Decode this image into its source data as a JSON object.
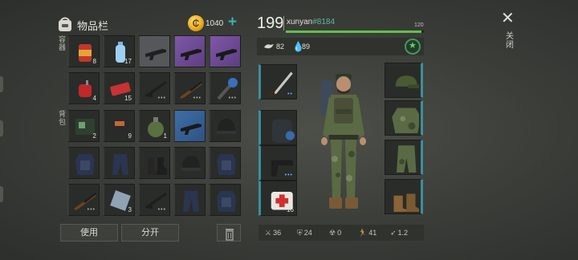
{
  "inventory": {
    "title": "物品栏",
    "coins": "1040",
    "add_coin": "+",
    "storage_label": "容器",
    "backpack_label": "背包",
    "storage_slots": [
      {
        "item": "canned-food",
        "qty": "8",
        "style": "dark"
      },
      {
        "item": "water-bottle",
        "qty": "17",
        "style": "dark"
      },
      {
        "item": "assault-rifle-gray",
        "qty": "",
        "style": "gray"
      },
      {
        "item": "assault-rifle-purple",
        "qty": "",
        "style": "purple"
      },
      {
        "item": "assault-rifle-purple",
        "qty": "",
        "style": "purple"
      },
      {
        "item": "gas-can",
        "qty": "4",
        "style": "dark"
      },
      {
        "item": "ticket",
        "qty": "15",
        "style": "dark"
      },
      {
        "item": "rifle",
        "qty": "",
        "style": "dark",
        "dots": "•••"
      },
      {
        "item": "shotgun",
        "qty": "",
        "style": "dark",
        "dots": "•••"
      },
      {
        "item": "spiked-club",
        "qty": "",
        "style": "dark",
        "dots": "•••"
      }
    ],
    "backpack_slots": [
      {
        "item": "notebook",
        "qty": "2",
        "style": "dark"
      },
      {
        "item": "book",
        "qty": "9",
        "style": "dark"
      },
      {
        "item": "grenade",
        "qty": "1",
        "style": "dark"
      },
      {
        "item": "assault-rifle-blue",
        "qty": "",
        "style": "blue"
      },
      {
        "item": "helmet",
        "qty": "",
        "style": "dark"
      },
      {
        "item": "body-armor",
        "qty": "",
        "style": "dark"
      },
      {
        "item": "pants",
        "qty": "",
        "style": "dark"
      },
      {
        "item": "boots",
        "qty": "",
        "style": "dark"
      },
      {
        "item": "helmet",
        "qty": "",
        "style": "dark"
      },
      {
        "item": "body-armor",
        "qty": "",
        "style": "dark"
      },
      {
        "item": "shotgun",
        "qty": "",
        "style": "dark",
        "dots": "•••"
      },
      {
        "item": "metal-plate",
        "qty": "3",
        "style": "dark"
      },
      {
        "item": "rifle",
        "qty": "",
        "style": "dark",
        "dots": "•••"
      },
      {
        "item": "pants",
        "qty": "",
        "style": "dark"
      },
      {
        "item": "body-armor",
        "qty": "",
        "style": "dark"
      }
    ],
    "use_button": "使用",
    "split_button": "分开"
  },
  "character": {
    "level": "199",
    "username": "xunyan",
    "user_id": "#8184",
    "xp_max": "120",
    "xp_fraction": 0.98,
    "food": "82",
    "water": "89",
    "left_slots": [
      {
        "item": "machete",
        "qty": "",
        "dots": "••"
      },
      {
        "item": "backpack",
        "qty": ""
      },
      {
        "item": "pistol",
        "qty": "",
        "dots": "•••"
      },
      {
        "item": "bandage",
        "qty": "16"
      }
    ],
    "right_slots": [
      {
        "item": "cap"
      },
      {
        "item": "camo-jacket"
      },
      {
        "item": "camo-pants"
      },
      {
        "item": "boots-tan"
      }
    ],
    "stats": {
      "attack": "36",
      "defense": "24",
      "radiation": "0",
      "speed": "41",
      "dash": "1.2"
    }
  },
  "close_label": "关闭",
  "colors": {
    "accent_teal": "#3bb4a8",
    "xp_green": "#5ec24a",
    "user_id_green": "#62b89c",
    "purple_rarity": "#7e58a6",
    "blue_rarity": "#3e6ea8"
  }
}
